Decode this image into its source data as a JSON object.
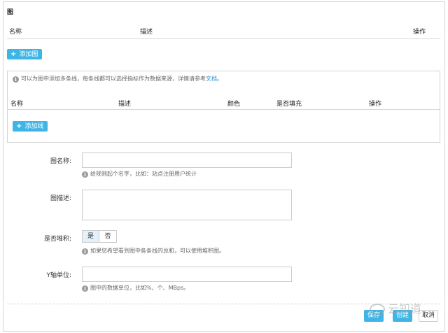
{
  "graph_section": {
    "title": "图",
    "col_name": "名称",
    "col_desc": "描述",
    "col_ops": "操作",
    "add_button": "添加图"
  },
  "series_panel": {
    "tip_text": "可以为图中添加多条线，每条线都可以选择指标作为数据来源，详情请参考",
    "tip_link": "文档",
    "tip_end": "。",
    "col_name": "名称",
    "col_desc": "描述",
    "col_color": "颜色",
    "col_fill": "是否填充",
    "col_ops": "操作",
    "add_button": "添加线"
  },
  "form": {
    "name_label": "图名称:",
    "name_value": "",
    "name_hint": "给规则起个名字，比如：站点注册用户统计",
    "desc_label": "图描述:",
    "desc_value": "",
    "stack_label": "是否堆积:",
    "stack_yes": "是",
    "stack_no": "否",
    "stack_selected": "是",
    "stack_hint": "如果您希望看到图中各条线的总和，可以使用堆积图。",
    "yunit_label": "Y轴单位:",
    "yunit_value": "",
    "yunit_hint": "图中的数据单位，比如%、个、MBps。"
  },
  "footer": {
    "save_label": "保存",
    "create_label": "创建",
    "cancel_label": "取消",
    "watermark": "云知道"
  },
  "icons": {
    "plus": "plus-icon",
    "info": "info-icon"
  },
  "colors": {
    "accent": "#3fb5e6",
    "link": "#2a8fd6",
    "border": "#d4d4d4"
  }
}
